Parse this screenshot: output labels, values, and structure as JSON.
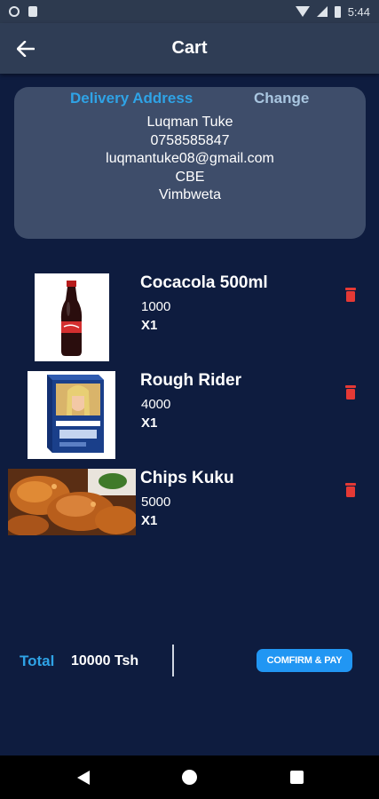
{
  "status_bar": {
    "time": "5:44",
    "icons": [
      "circle-icon",
      "sim-card-icon",
      "wifi-icon",
      "signal-icon",
      "battery-icon"
    ]
  },
  "app_bar": {
    "title": "Cart",
    "back_icon": "arrow-left-icon"
  },
  "address": {
    "heading": "Delivery Address",
    "change_label": "Change",
    "name": "Luqman Tuke",
    "phone": "0758585847",
    "email": "luqmantuke08@gmail.com",
    "line1": "CBE",
    "line2": "Vimbweta"
  },
  "items": [
    {
      "name": "Cocacola 500ml",
      "price": "1000",
      "qty": "X1",
      "image": "cocacola-bottle-image"
    },
    {
      "name": "Rough Rider",
      "price": "4000",
      "qty": "X1",
      "image": "rough-rider-pack-image"
    },
    {
      "name": "Chips Kuku",
      "price": "5000",
      "qty": "X1",
      "image": "chips-kuku-image"
    }
  ],
  "footer": {
    "total_label": "Total",
    "total_value": "10000 Tsh",
    "confirm_label": "COMFIRM & PAY"
  },
  "colors": {
    "background": "#0e1c3f",
    "app_bar": "#2f3d55",
    "card": "#3e4d6a",
    "accent_blue": "#2fa3e6",
    "button_blue": "#2196f3",
    "delete_red": "#e53935"
  },
  "nav_bar": {
    "icons": [
      "back-triangle-icon",
      "home-circle-icon",
      "recents-square-icon"
    ]
  }
}
